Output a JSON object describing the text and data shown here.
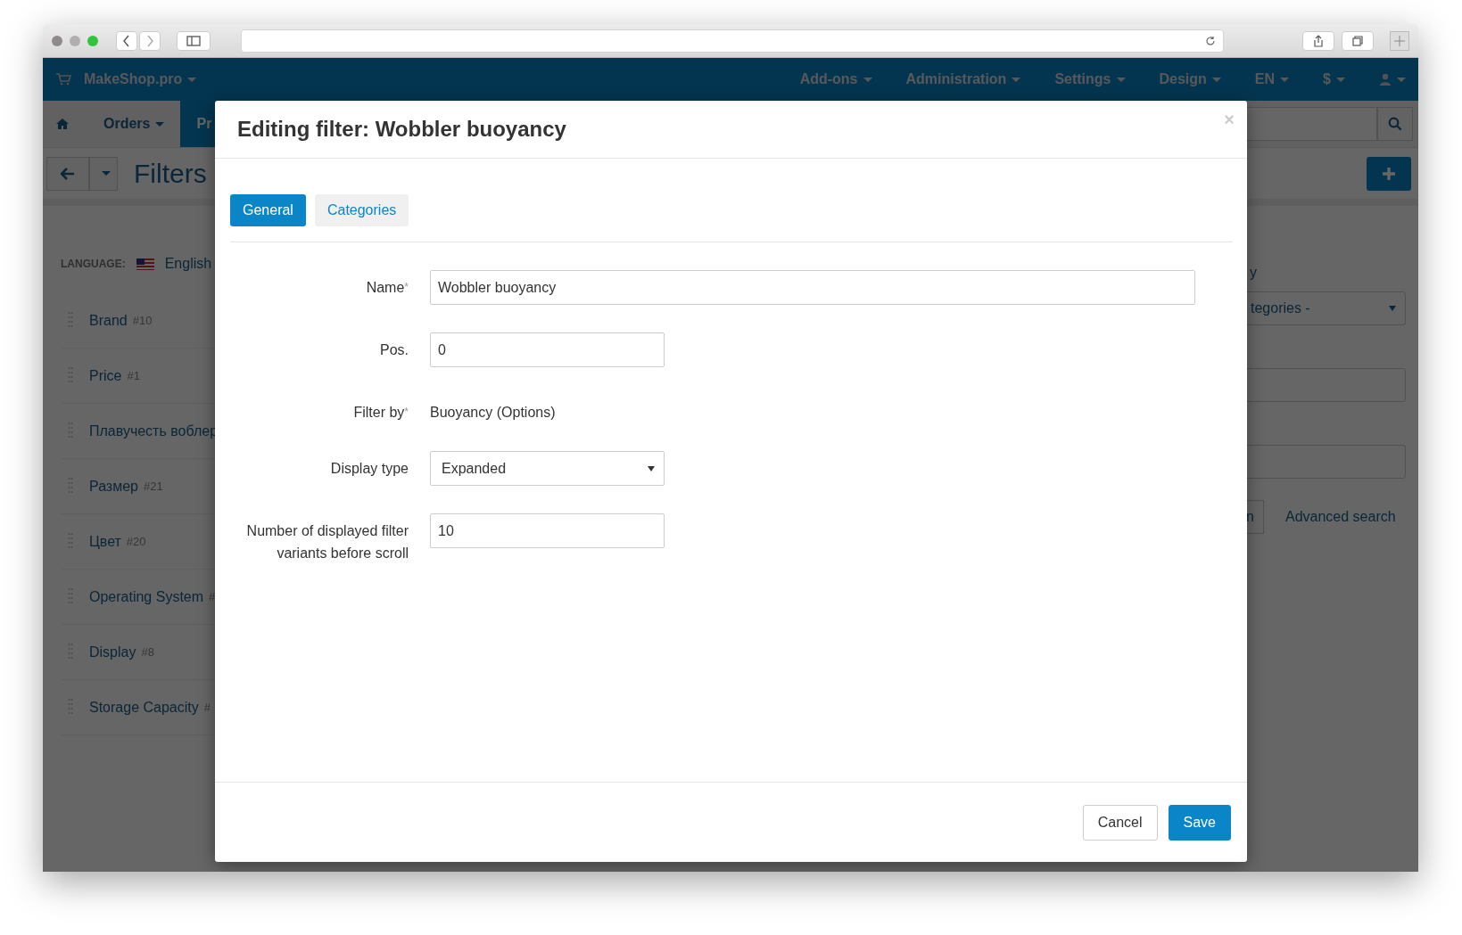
{
  "navbar": {
    "brand": "MakeShop.pro",
    "menu": [
      {
        "label": "Add-ons"
      },
      {
        "label": "Administration"
      },
      {
        "label": "Settings"
      },
      {
        "label": "Design"
      },
      {
        "label": "EN"
      },
      {
        "label": "$"
      }
    ]
  },
  "subnav": {
    "items": [
      {
        "label": "Orders",
        "selected": false
      },
      {
        "label": "Pr",
        "selected": true
      }
    ]
  },
  "page_title": "Filters",
  "sidebar": {
    "language_label": "LANGUAGE:",
    "language": "English",
    "filters": [
      {
        "name": "Brand",
        "id": "#10"
      },
      {
        "name": "Price",
        "id": "#1"
      },
      {
        "name": "Плавучесть воблер"
      },
      {
        "name": "Размер",
        "id": "#21"
      },
      {
        "name": "Цвет",
        "id": "#20"
      },
      {
        "name": "Operating System",
        "id": "#"
      },
      {
        "name": "Display",
        "id": "#8"
      },
      {
        "name": "Storage Capacity",
        "id": "#"
      }
    ]
  },
  "search_panel": {
    "label_fragment": "y",
    "category_select": "tegories -",
    "button_fragment": "n",
    "advanced_link": "Advanced search"
  },
  "modal": {
    "title": "Editing filter: Wobbler buoyancy",
    "close": "×",
    "required_mark": "*",
    "tabs": [
      {
        "label": "General",
        "selected": true
      },
      {
        "label": "Categories",
        "selected": false
      }
    ],
    "fields": [
      {
        "kind": "input",
        "label": "Name",
        "required": true,
        "value": "Wobbler buoyancy",
        "wide": true
      },
      {
        "kind": "input",
        "label": "Pos.",
        "required": false,
        "value": "0",
        "wide": false
      },
      {
        "kind": "text",
        "label": "Filter by",
        "required": true,
        "value": "Buoyancy (Options)"
      },
      {
        "kind": "select",
        "label": "Display type",
        "required": false,
        "value": "Expanded"
      },
      {
        "kind": "input",
        "label": "Number of displayed filter variants before scroll",
        "required": false,
        "value": "10",
        "wide": false
      }
    ],
    "buttons": [
      {
        "label": "Cancel",
        "kind": "secondary"
      },
      {
        "label": "Save",
        "kind": "primary"
      }
    ]
  }
}
